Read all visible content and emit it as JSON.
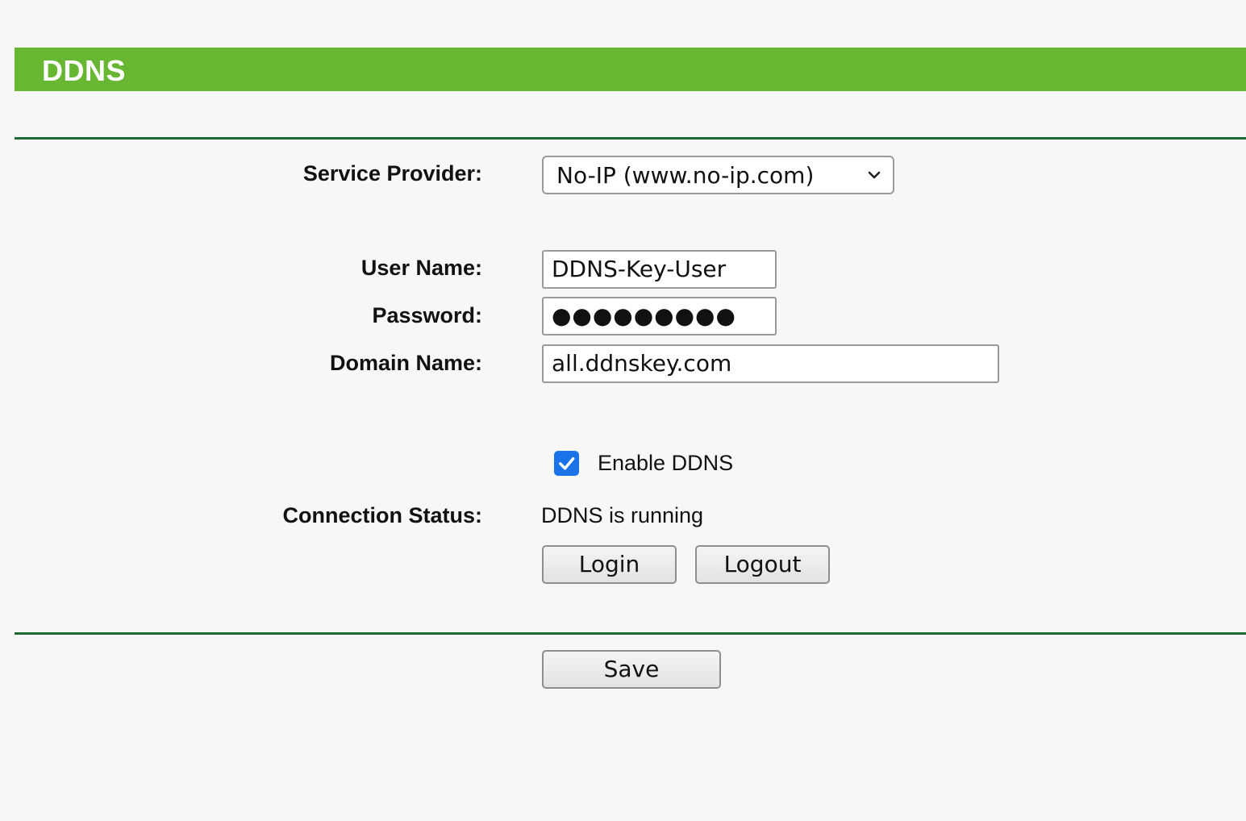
{
  "header": {
    "title": "DDNS",
    "accent_color": "#67b733"
  },
  "form": {
    "service_provider": {
      "label": "Service Provider:",
      "selected": "No-IP (www.no-ip.com)"
    },
    "user_name": {
      "label": "User Name:",
      "value": "DDNS-Key-User"
    },
    "password": {
      "label": "Password:",
      "value": "●●●●●●●●●"
    },
    "domain_name": {
      "label": "Domain Name:",
      "value": "all.ddnskey.com"
    },
    "enable_ddns": {
      "label": "Enable DDNS",
      "checked": true
    },
    "connection_status": {
      "label": "Connection Status:",
      "value": "DDNS is running"
    },
    "buttons": {
      "login": "Login",
      "logout": "Logout",
      "save": "Save"
    }
  },
  "colors": {
    "divider": "#1f6b35",
    "checkbox": "#1a73e8"
  },
  "icons": {
    "select_arrow": "chevron-down-icon",
    "checkbox_mark": "checkmark-icon"
  }
}
